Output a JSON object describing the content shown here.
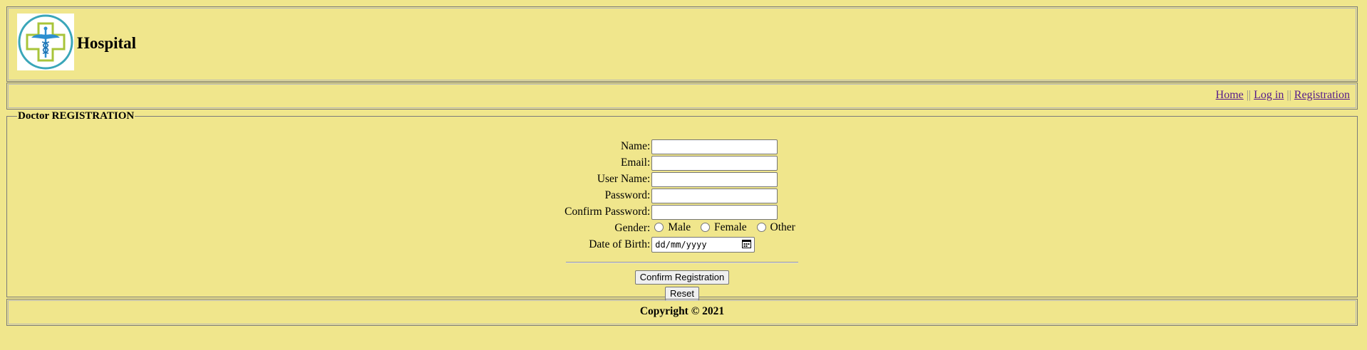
{
  "header": {
    "site_title": "Hospital",
    "logo_icon": "hospital-cross-caduceus-icon"
  },
  "nav": {
    "links": [
      {
        "label": "Home"
      },
      {
        "label": "Log in"
      },
      {
        "label": "Registration"
      }
    ],
    "separator": "||"
  },
  "registration": {
    "legend": "Doctor REGISTRATION",
    "fields": {
      "name": {
        "label": "Name:",
        "value": ""
      },
      "email": {
        "label": "Email:",
        "value": ""
      },
      "username": {
        "label": "User Name:",
        "value": ""
      },
      "password": {
        "label": "Password:",
        "value": ""
      },
      "confirm_password": {
        "label": "Confirm Password:",
        "value": ""
      }
    },
    "gender": {
      "label": "Gender:",
      "options": [
        "Male",
        "Female",
        "Other"
      ]
    },
    "dob": {
      "label": "Date of Birth:",
      "placeholder": "dd/mm/yyyy"
    },
    "buttons": {
      "confirm": "Confirm Registration",
      "reset": "Reset"
    }
  },
  "footer": {
    "copyright": "Copyright © 2021"
  },
  "colors": {
    "page_background": "#f0e68c",
    "link": "#551a8b",
    "logo_ring": "#3aa6b9",
    "logo_cross": "#a8c43a"
  }
}
